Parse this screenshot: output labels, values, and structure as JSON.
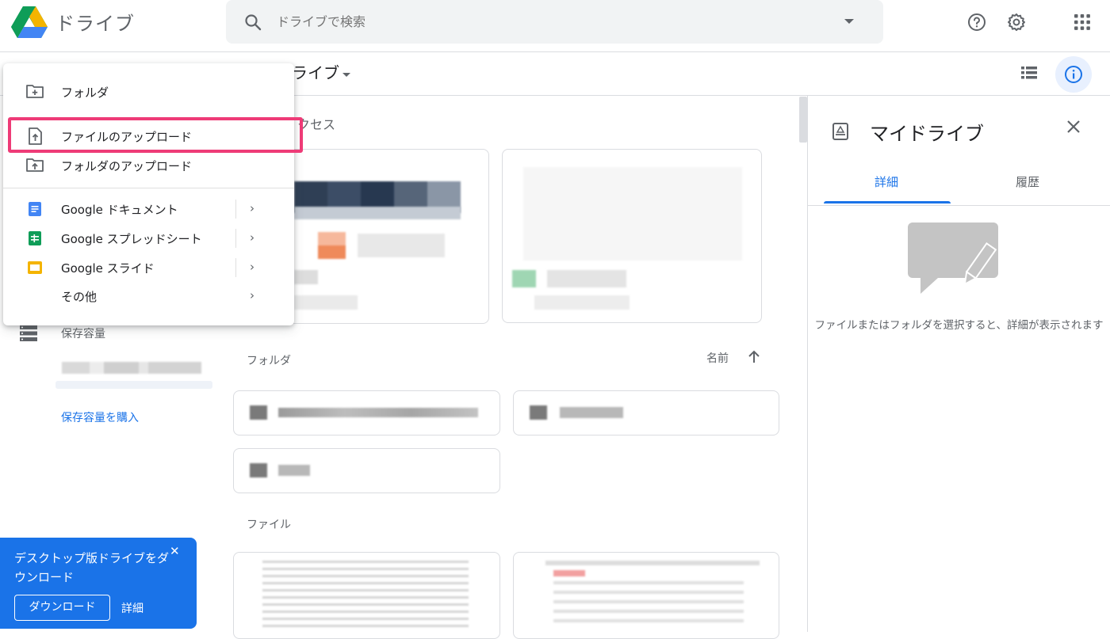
{
  "header": {
    "app_title": "ドライブ",
    "search_placeholder": "ドライブで検索",
    "icons": [
      "drive-logo-icon",
      "search-icon",
      "search-options-icon",
      "help-icon",
      "settings-icon",
      "apps-grid-icon"
    ]
  },
  "subbar": {
    "breadcrumb": "ライブ",
    "icons": [
      "list-view-icon",
      "info-icon"
    ]
  },
  "main": {
    "quick_access_label": "クセス",
    "folders_label": "フォルダ",
    "sort_label": "名前",
    "files_label": "ファイル"
  },
  "sidebar": {
    "storage_label": "保存容量",
    "buy_storage": "保存容量を購入"
  },
  "new_menu": {
    "items": [
      {
        "label": "フォルダ",
        "icon": "new-folder-icon"
      },
      {
        "label": "ファイルのアップロード",
        "icon": "file-upload-icon"
      },
      {
        "label": "フォルダのアップロード",
        "icon": "folder-upload-icon"
      },
      {
        "label": "Google ドキュメント",
        "icon": "google-docs-icon"
      },
      {
        "label": "Google スプレッドシート",
        "icon": "google-sheets-icon"
      },
      {
        "label": "Google スライド",
        "icon": "google-slides-icon"
      },
      {
        "label": "その他",
        "icon": ""
      }
    ],
    "highlight_color": "#ee3b77"
  },
  "details_panel": {
    "title": "マイドライブ",
    "tabs": [
      "詳細",
      "履歴"
    ],
    "empty_text": "ファイルまたはフォルダを選択すると、詳細が表示されます"
  },
  "banner": {
    "text": "デスクトップ版ドライブをダウンロード",
    "close": "✕",
    "download_button": "ダウンロード",
    "details_link": "詳細"
  },
  "colors": {
    "accent": "#1a73e8",
    "drive_green": "#0f9d58",
    "drive_yellow": "#f4b400",
    "drive_blue": "#4285f4"
  }
}
